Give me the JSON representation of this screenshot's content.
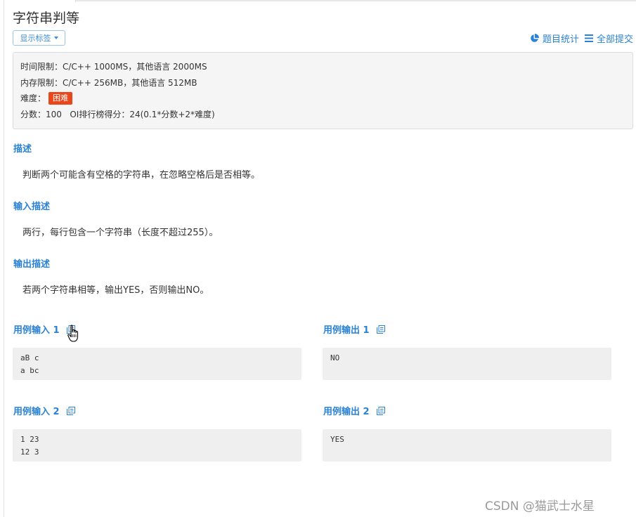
{
  "title": "字符串判等",
  "tag_button": "显示标签",
  "top_links": [
    {
      "icon": "pie-chart-icon",
      "label": "题目统计"
    },
    {
      "icon": "list-icon",
      "label": "全部提交"
    }
  ],
  "info": {
    "time_limit": "时间限制：C/C++ 1000MS，其他语言 2000MS",
    "memory_limit": "内存限制：C/C++ 256MB，其他语言 512MB",
    "difficulty_label": "难度：",
    "difficulty_value": "困难",
    "score": "分数：100   OI排行榜得分：24(0.1*分数+2*难度)"
  },
  "sections": [
    {
      "title": "描述",
      "text": "判断两个可能含有空格的字符串，在忽略空格后是否相等。"
    },
    {
      "title": "输入描述",
      "text": "两行，每行包含一个字符串（长度不超过255）。"
    },
    {
      "title": "输出描述",
      "text": "若两个字符串相等，输出YES，否则输出NO。"
    }
  ],
  "examples": [
    {
      "input_title": "用例输入 1",
      "input_lines": [
        "aB c",
        "a bc"
      ],
      "output_title": "用例输出 1",
      "output_lines": [
        "NO"
      ]
    },
    {
      "input_title": "用例输入 2",
      "input_lines": [
        "1 23",
        "12 3"
      ],
      "output_title": "用例输出 2",
      "output_lines": [
        "YES"
      ]
    }
  ],
  "watermark": "CSDN @猫武士水星",
  "colors": {
    "accent": "#2a82d6",
    "badge": "#e8471c",
    "panel": "#f5f5f5",
    "code_bg": "#efefef"
  }
}
